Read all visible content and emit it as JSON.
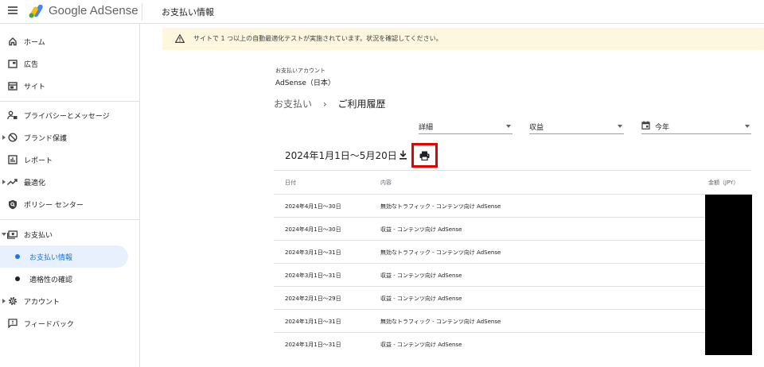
{
  "app": {
    "name": "Google AdSense",
    "page_title": "お支払い情報"
  },
  "sidebar": {
    "items": [
      {
        "label": "ホーム",
        "icon": "home-icon"
      },
      {
        "label": "広告",
        "icon": "ads-icon"
      },
      {
        "label": "サイト",
        "icon": "sites-icon"
      },
      {
        "label": "プライバシーとメッセージ",
        "icon": "privacy-icon"
      },
      {
        "label": "ブランド保護",
        "icon": "brand-safety-icon"
      },
      {
        "label": "レポート",
        "icon": "reports-icon"
      },
      {
        "label": "最適化",
        "icon": "optimization-icon"
      },
      {
        "label": "ポリシー センター",
        "icon": "policy-icon"
      },
      {
        "label": "お支払い",
        "icon": "payments-icon"
      },
      {
        "label": "お支払い情報",
        "icon": ""
      },
      {
        "label": "適格性の確認",
        "icon": ""
      },
      {
        "label": "アカウント",
        "icon": "gear-icon"
      },
      {
        "label": "フィードバック",
        "icon": "feedback-icon"
      }
    ]
  },
  "banner": {
    "text": "サイトで 1 つ以上の自動最適化テストが実施されています。状況を確認してください。"
  },
  "account": {
    "label": "お支払いアカウント",
    "name": "AdSense（日本）"
  },
  "breadcrumb": {
    "parent": "お支払い",
    "current": "ご利用履歴"
  },
  "filters": {
    "detail": "詳細",
    "type": "収益",
    "period": "今年"
  },
  "date_range": "2024年1月1日～5月20日",
  "table": {
    "headers": {
      "date": "日付",
      "desc": "内容",
      "amount": "金額（JPY）"
    },
    "rows": [
      {
        "date": "2024年4月1日～30日",
        "desc": "無効なトラフィック - コンテンツ向け AdSense"
      },
      {
        "date": "2024年4月1日～30日",
        "desc": "収益 - コンテンツ向け AdSense"
      },
      {
        "date": "2024年3月1日～31日",
        "desc": "無効なトラフィック - コンテンツ向け AdSense"
      },
      {
        "date": "2024年3月1日～31日",
        "desc": "収益 - コンテンツ向け AdSense"
      },
      {
        "date": "2024年2月1日～29日",
        "desc": "収益 - コンテンツ向け AdSense"
      },
      {
        "date": "2024年1月1日～31日",
        "desc": "無効なトラフィック - コンテンツ向け AdSense"
      },
      {
        "date": "2024年1月1日～31日",
        "desc": "収益 - コンテンツ向け AdSense"
      }
    ]
  },
  "colors": {
    "accent": "#1a73e8",
    "active_bg": "#e8f0fe",
    "banner_bg": "#fef7e0",
    "highlight": "#e50000"
  }
}
